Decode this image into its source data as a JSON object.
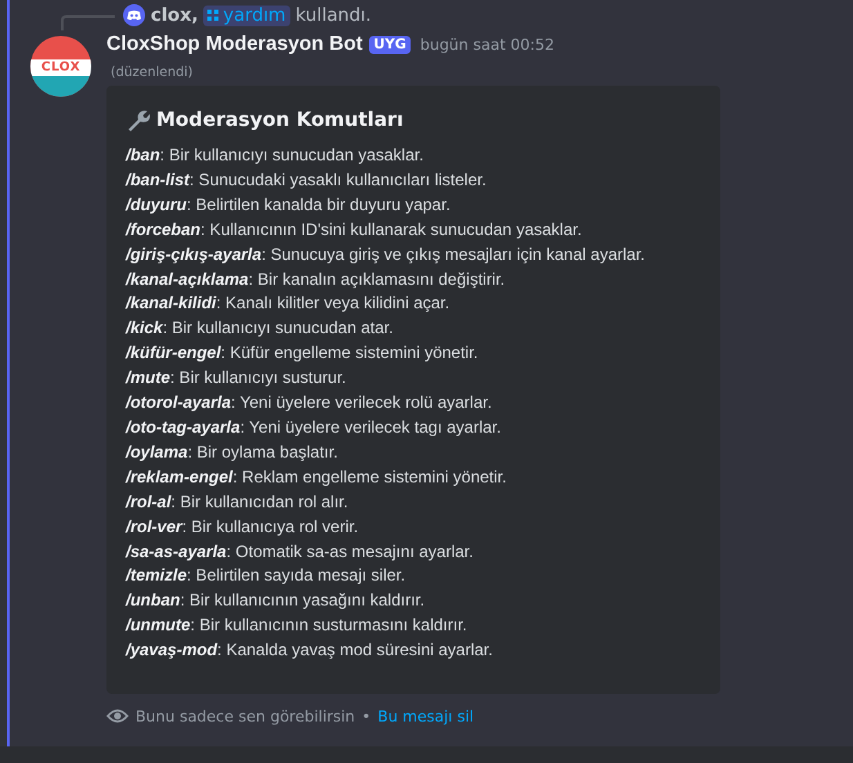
{
  "reply": {
    "user": "clox,",
    "command": "yardım",
    "suffix": "kullandı."
  },
  "message": {
    "author": "CloxShop Moderasyon Bot",
    "tag": "UYG",
    "timestamp": "bugün saat 00:52",
    "avatar_text": "CLOX",
    "edited": "(düzenlendi)"
  },
  "embed": {
    "title": "Moderasyon Komutları",
    "lines": [
      "**/ban**: Bir kullanıcıyı sunucudan yasaklar.",
      "**/ban-list**: Sunucudaki yasaklı kullanıcıları listeler.",
      "**/duyuru**: Belirtilen kanalda bir duyuru yapar.",
      "**/forceban**: Kullanıcının ID'sini kullanarak sunucudan yasaklar.",
      "**/giriş-çıkış-ayarla**: Sunucuya giriş ve çıkış mesajları için kanal ayarlar.",
      "**/kanal-açıklama**: Bir kanalın açıklamasını değiştirir.",
      "**/kanal-kilidi**: Kanalı kilitler veya kilidini açar.",
      "**/kick**: Bir kullanıcıyı sunucudan atar.",
      "**/küfür-engel**: Küfür engelleme sistemini yönetir.",
      "**/mute**: Bir kullanıcıyı susturur.",
      "**/otorol-ayarla**: Yeni üyelere verilecek rolü ayarlar.",
      "**/oto-tag-ayarla**: Yeni üyelere verilecek tagı ayarlar.",
      "**/oylama**: Bir oylama başlatır.",
      "**/reklam-engel**: Reklam engelleme sistemini yönetir.",
      "**/rol-al**: Bir kullanıcıdan rol alır.",
      "**/rol-ver**: Bir kullanıcıya rol verir.",
      "**/sa-as-ayarla**: Otomatik sa-as mesajını ayarlar.",
      "**/temizle**: Belirtilen sayıda mesajı siler.",
      "**/unban**: Bir kullanıcının yasağını kaldırır.",
      "**/unmute**: Bir kullanıcının susturmasını kaldırır.",
      "**/yavaş-mod**: Kanalda yavaş mod süresini ayarlar."
    ]
  },
  "footer": {
    "notice": "Bunu sadece sen görebilirsin",
    "separator": "•",
    "link": "Bu mesajı sil"
  }
}
